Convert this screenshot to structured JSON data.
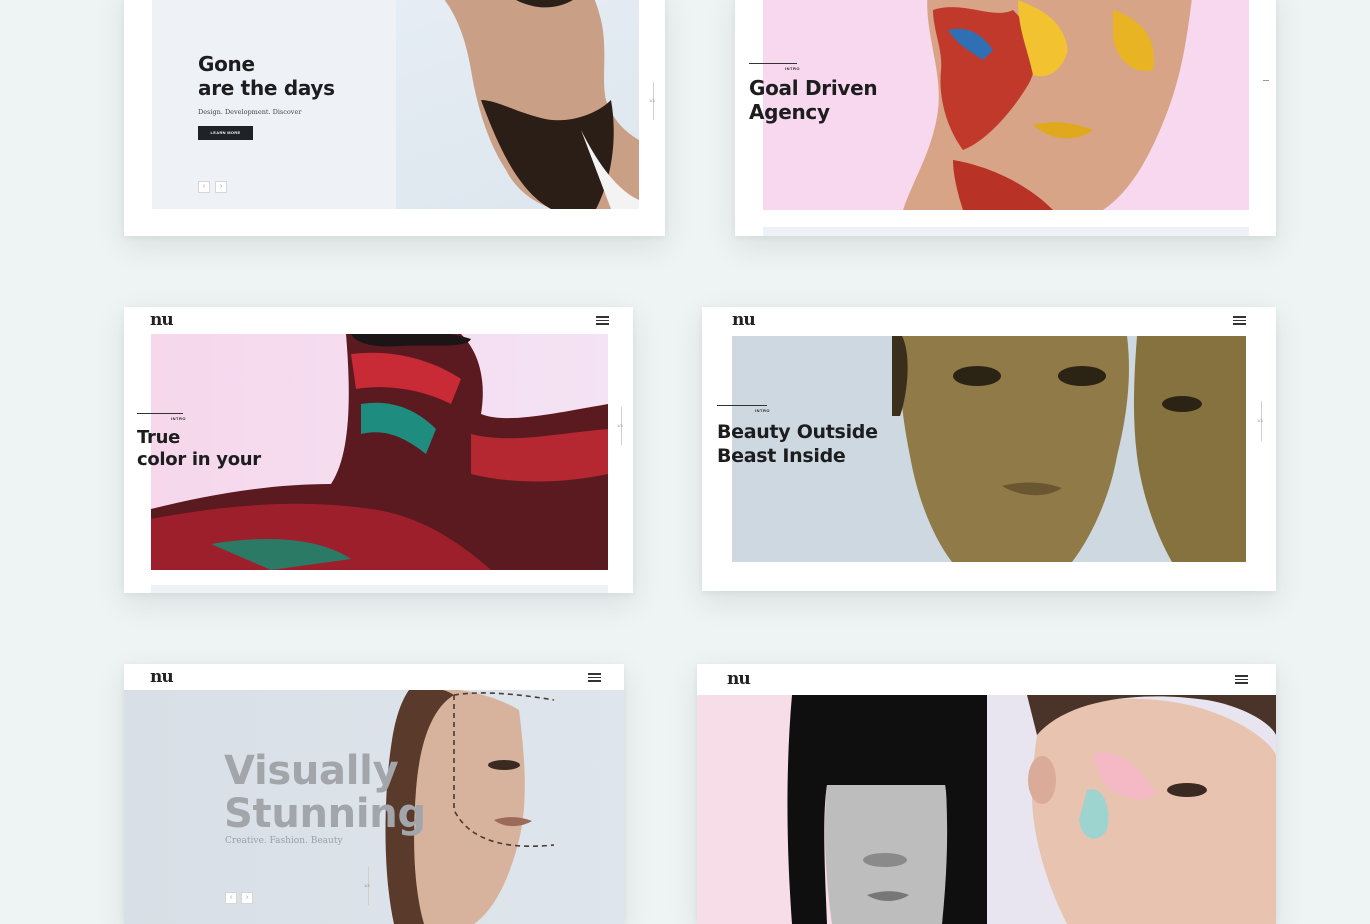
{
  "cards": {
    "gone": {
      "headline": "Gone\nare the days",
      "subtitle": "Design. Development. Discover",
      "button_label": "LEARN MORE",
      "prev_arrow": "‹",
      "next_arrow": "›",
      "slide_num": "1/3"
    },
    "goal": {
      "intro": "INTRO",
      "headline": "Goal Driven\nAgency"
    },
    "true_color": {
      "logo": "nu",
      "intro": "INTRO",
      "headline": "True\ncolor in your",
      "slide_num": "1/3"
    },
    "beauty": {
      "logo": "nu",
      "intro": "INTRO",
      "headline": "Beauty Outside\nBeast Inside",
      "slide_num": "1/3"
    },
    "visually": {
      "logo": "nu",
      "headline": "Visually\nStunning",
      "subtitle": "Creative. Fashion. Beauty",
      "prev_arrow": "‹",
      "next_arrow": "›",
      "slide_num": "1/3"
    },
    "split": {
      "logo": "nu"
    }
  },
  "colors": {
    "page_bg": "#eef3f3",
    "pink": "#f7d9ec",
    "blue_grey": "#cdd8e0",
    "pale_blue": "#e4ecf3"
  }
}
